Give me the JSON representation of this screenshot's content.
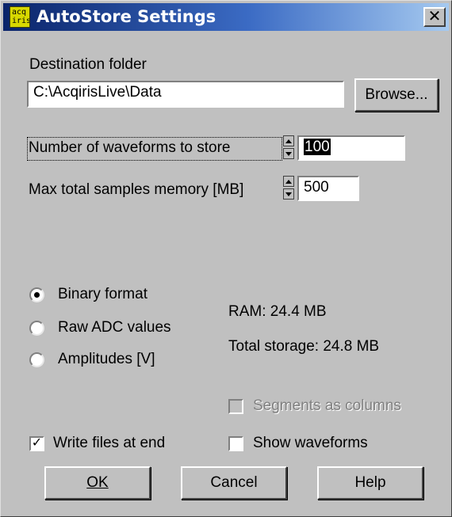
{
  "window": {
    "title": "AutoStore Settings",
    "icon_text": [
      "acq",
      "iris"
    ],
    "close_glyph": "✕"
  },
  "destination": {
    "label": "Destination folder",
    "path": "C:\\AcqirisLive\\Data",
    "browse_label": "Browse..."
  },
  "waveforms": {
    "label": "Number of waveforms to store",
    "value": "100"
  },
  "memory": {
    "label": "Max total samples memory [MB]",
    "value": "500"
  },
  "format": {
    "options": [
      "Binary format",
      "Raw ADC values",
      "Amplitudes [V]"
    ],
    "selected": "Binary format"
  },
  "stats": {
    "ram": "RAM: 24.4 MB",
    "storage": "Total storage: 24.8 MB"
  },
  "options": {
    "segments_label": "Segments as columns",
    "segments_checked": false,
    "segments_enabled": false,
    "write_files_label": "Write files at end",
    "write_files_checked": true,
    "show_waveforms_label": "Show waveforms",
    "show_waveforms_checked": false
  },
  "buttons": {
    "ok": "OK",
    "cancel": "Cancel",
    "help": "Help"
  }
}
